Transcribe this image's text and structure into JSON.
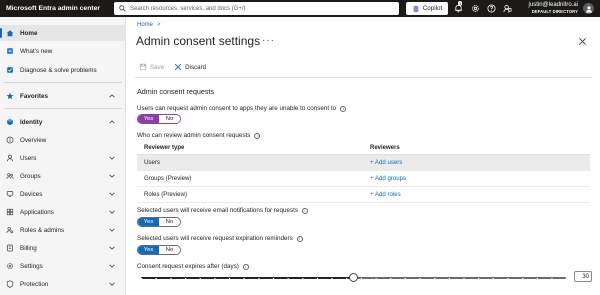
{
  "app": {
    "title": "Microsoft Entra admin center",
    "search_placeholder": "Search resources, services, and docs (G+/)",
    "copilot_label": "Copilot",
    "notification_count": "1",
    "user_email": "justin@leadnitro.ai",
    "directory": "DEFAULT DIRECTORY"
  },
  "sidebar": {
    "items": [
      {
        "label": "Home",
        "icon": "home-icon"
      },
      {
        "label": "What's new",
        "icon": "whats-new-icon"
      },
      {
        "label": "Diagnose & solve problems",
        "icon": "diagnose-icon"
      },
      {
        "label": "Favorites",
        "icon": "star-icon"
      },
      {
        "label": "Identity",
        "icon": "identity-icon"
      },
      {
        "label": "Overview",
        "icon": "info-circle-icon"
      },
      {
        "label": "Users",
        "icon": "user-icon"
      },
      {
        "label": "Groups",
        "icon": "groups-icon"
      },
      {
        "label": "Devices",
        "icon": "devices-icon"
      },
      {
        "label": "Applications",
        "icon": "applications-icon"
      },
      {
        "label": "Roles & admins",
        "icon": "roles-icon"
      },
      {
        "label": "Billing",
        "icon": "billing-icon"
      },
      {
        "label": "Settings",
        "icon": "settings-icon"
      },
      {
        "label": "Protection",
        "icon": "protection-icon"
      }
    ]
  },
  "main": {
    "breadcrumb": [
      "Home"
    ],
    "title": "Admin consent settings",
    "toolbar": {
      "save_label": "Save",
      "discard_label": "Discard"
    },
    "section_heading": "Admin consent requests",
    "request_consent_label": "Users can request admin consent to apps they are unable to consent to",
    "request_consent_toggle": {
      "yes": "Yes",
      "no": "No",
      "selected": "Yes"
    },
    "who_can_review_label": "Who can review admin consent requests",
    "table": {
      "headers": [
        "Reviewer type",
        "Reviewers"
      ],
      "rows": [
        {
          "type": "Users",
          "action": "+ Add users"
        },
        {
          "type": "Groups (Preview)",
          "action": "+ Add groups"
        },
        {
          "type": "Roles (Preview)",
          "action": "+ Add roles"
        }
      ]
    },
    "email_notifications_label": "Selected users will receive email notifications for requests",
    "email_notifications_toggle": {
      "yes": "Yes",
      "no": "No",
      "selected": "Yes"
    },
    "expiration_reminders_label": "Selected users will receive request expiration reminders",
    "expiration_reminders_toggle": {
      "yes": "Yes",
      "no": "No",
      "selected": "Yes"
    },
    "expires_label": "Consent request expires after (days)",
    "expires_value": "30",
    "expires_slider": {
      "min": 1,
      "max": 30,
      "value": 30,
      "fill_fraction": 0.5
    }
  },
  "colors": {
    "accent": "#0f6cbd",
    "toggle_purple": "#8a3ea6",
    "topbar": "#1b1a19"
  }
}
